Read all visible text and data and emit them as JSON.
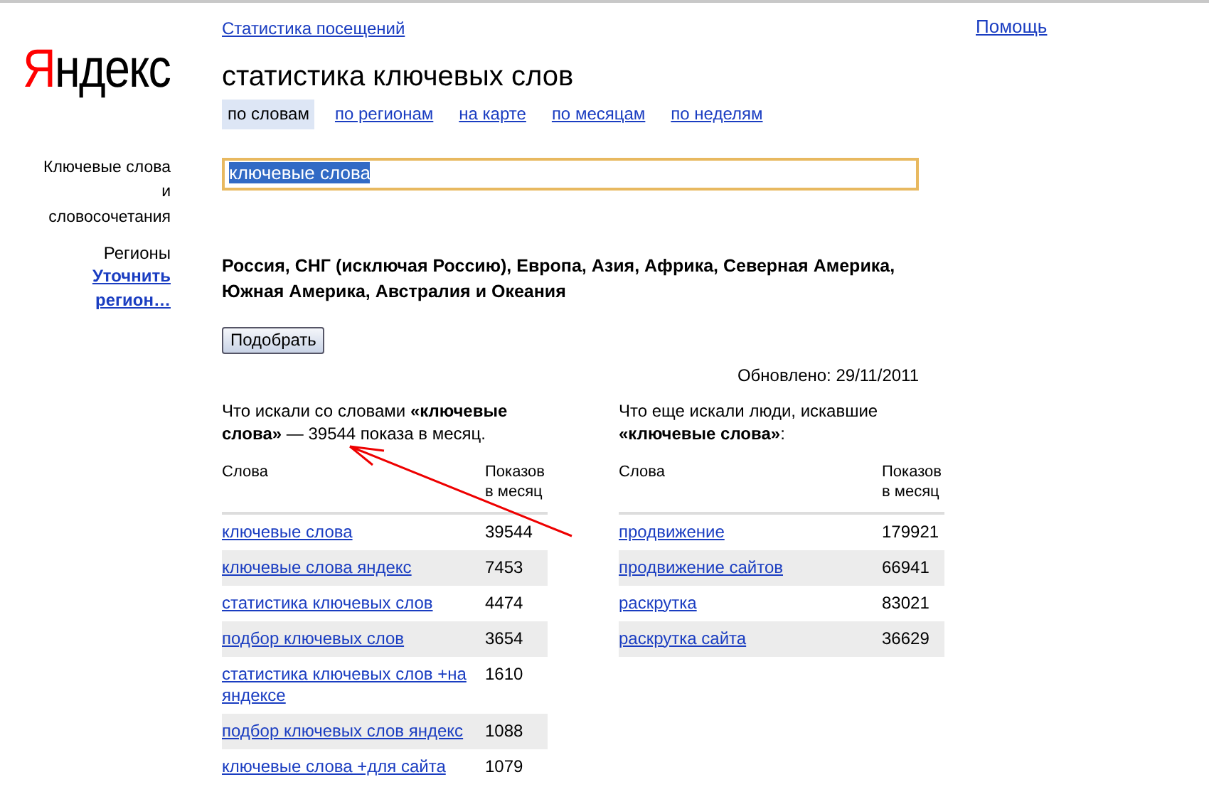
{
  "logo": {
    "first": "Я",
    "rest": "ндекс"
  },
  "top_link": "Статистика посещений",
  "help_link": "Помощь",
  "title": "статистика ключевых слов",
  "tabs": [
    {
      "label": "по словам",
      "selected": true
    },
    {
      "label": "по регионам",
      "selected": false
    },
    {
      "label": "на карте",
      "selected": false
    },
    {
      "label": "по месяцам",
      "selected": false
    },
    {
      "label": "по неделям",
      "selected": false
    }
  ],
  "sidebar": {
    "keywords_label": "Ключевые слова и словосочетания",
    "regions_label": "Регионы",
    "regions_link": "Уточнить регион…"
  },
  "search": {
    "value": "ключевые слова",
    "text_selected": true
  },
  "regions": "Россия, СНГ (исключая Россию), Европа, Азия, Африка, Северная Америка, Южная Америка, Австралия и Океания",
  "submit_button": "Подобрать",
  "updated": "Обновлено: 29/11/2011",
  "left_table": {
    "caption": "Что искали со словами **«ключевые слова»** — 39544 показа в месяц.",
    "columns": [
      "Слова",
      "Показов в месяц"
    ],
    "rows": [
      {
        "phrase": "ключевые слова",
        "count": "39544"
      },
      {
        "phrase": "ключевые слова яндекс",
        "count": "7453"
      },
      {
        "phrase": "статистика ключевых слов",
        "count": "4474"
      },
      {
        "phrase": "подбор ключевых слов",
        "count": "3654"
      },
      {
        "phrase": "статистика ключевых слов +на яндексе",
        "count": "1610"
      },
      {
        "phrase": "подбор ключевых слов яндекс",
        "count": "1088"
      },
      {
        "phrase": "ключевые слова +для сайта",
        "count": "1079"
      }
    ]
  },
  "right_table": {
    "caption": "Что еще искали люди, искавшие **«ключевые слова»**:",
    "columns": [
      "Слова",
      "Показов в месяц"
    ],
    "rows": [
      {
        "phrase": "продвижение",
        "count": "179921"
      },
      {
        "phrase": "продвижение сайтов",
        "count": "66941"
      },
      {
        "phrase": "раскрутка",
        "count": "83021"
      },
      {
        "phrase": "раскрутка сайта",
        "count": "36629"
      }
    ]
  }
}
